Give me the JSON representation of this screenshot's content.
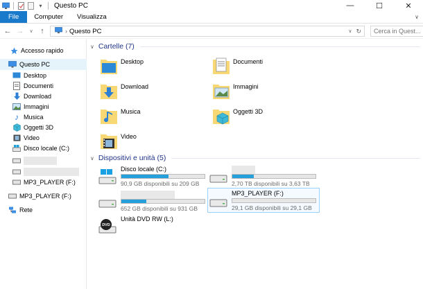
{
  "window": {
    "title": "Questo PC",
    "controls": {
      "minimize": "—",
      "maximize": "☐",
      "close": "✕"
    }
  },
  "ribbon": {
    "tabs": [
      "File",
      "Computer",
      "Visualizza"
    ],
    "expand": "∨"
  },
  "address": {
    "path": "Questo PC",
    "search_placeholder": "Cerca in Quest..."
  },
  "nav": {
    "quick_access": "Accesso rapido",
    "this_pc": "Questo PC",
    "pc_items": [
      "Desktop",
      "Documenti",
      "Download",
      "Immagini",
      "Musica",
      "Oggetti 3D",
      "Video",
      "Disco locale (C:)"
    ],
    "mp3_drive": "MP3_PLAYER (F:)",
    "mp3_root": "MP3_PLAYER (F:)",
    "network": "Rete"
  },
  "folders": {
    "header": "Cartelle (7)",
    "items": [
      "Desktop",
      "Documenti",
      "Download",
      "Immagini",
      "Musica",
      "Oggetti 3D",
      "Video"
    ]
  },
  "devices": {
    "header": "Dispositivi e unità (5)",
    "drives": [
      {
        "name": "Disco locale (C:)",
        "info": "90,9 GB disponibili su 209 GB",
        "used_fraction": 0.57
      },
      {
        "name": "",
        "info": "2,70 TB disponibili su 3,63 TB",
        "used_fraction": 0.26
      },
      {
        "name": "",
        "info": "652 GB disponibili su 931 GB",
        "used_fraction": 0.3
      },
      {
        "name": "MP3_PLAYER (F:)",
        "info": "29,1 GB disponibili su 29,1 GB",
        "used_fraction": 0.0
      },
      {
        "name": "Unità DVD RW (L:)",
        "info": ""
      }
    ]
  },
  "colors": {
    "accent": "#1979ca",
    "header_text": "#1e3287",
    "bar_fill": "#26a0da",
    "selection": "#e5f3fb"
  }
}
